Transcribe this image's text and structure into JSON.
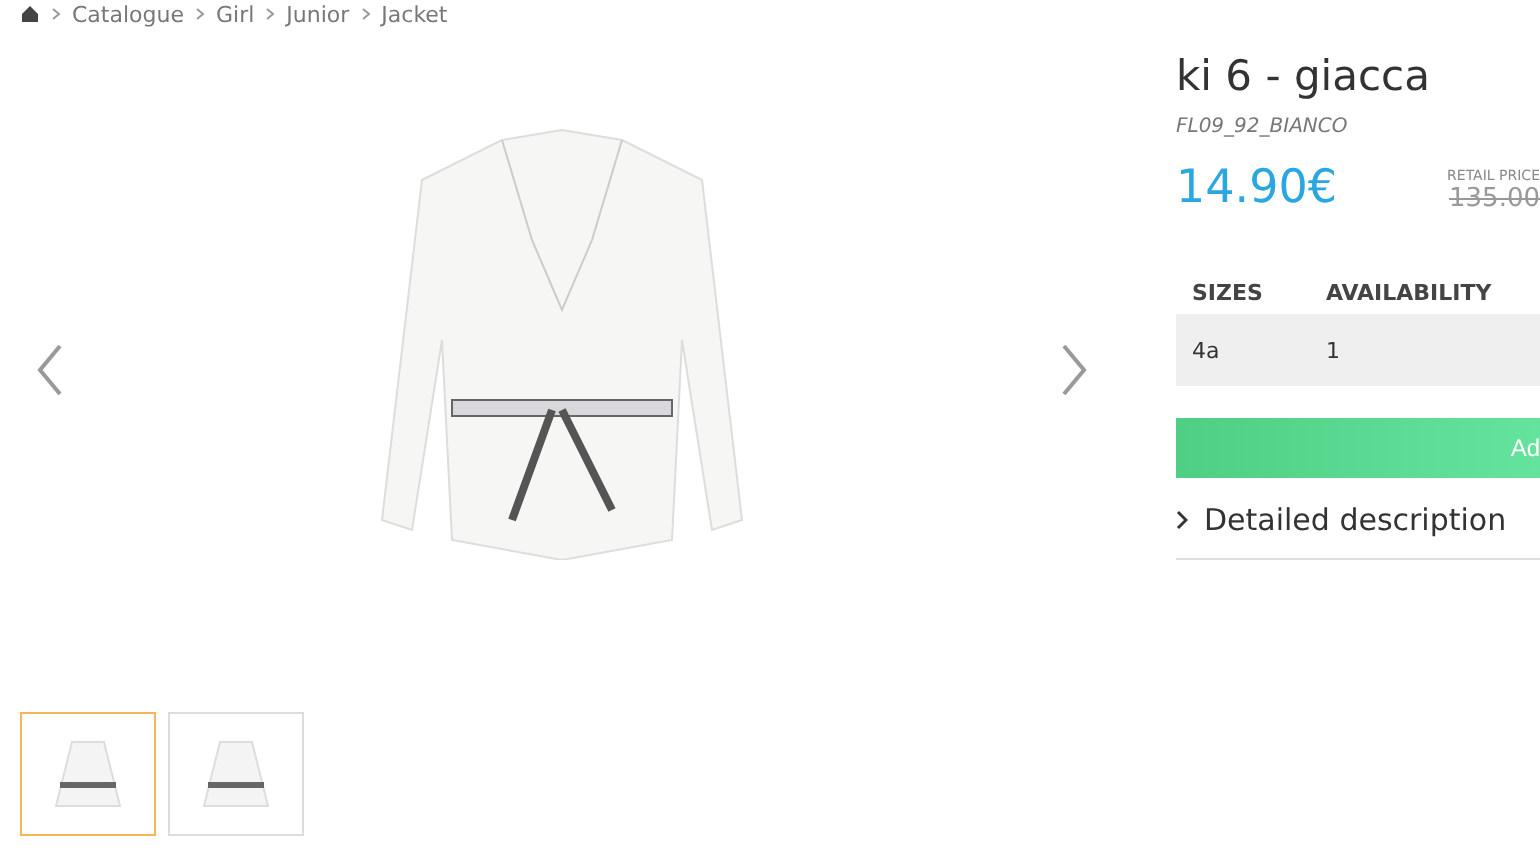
{
  "breadcrumb": [
    "Catalogue",
    "Girl",
    "Junior",
    "Jacket"
  ],
  "gallery": {
    "thumbnails": [
      {
        "selected": true
      },
      {
        "selected": false
      }
    ]
  },
  "product": {
    "title": "ki 6 - giacca",
    "sku": "FL09_92_BIANCO",
    "price": "14.90€",
    "retail_label": "RETAIL PRICE",
    "retail_price": "135.00"
  },
  "stock_table": {
    "columns": [
      "SIZES",
      "AVAILABILITY"
    ],
    "rows": [
      [
        "4a",
        "1"
      ]
    ]
  },
  "add_button": "Ad",
  "detail_toggle": {
    "label": "Detailed description",
    "expanded": false
  }
}
